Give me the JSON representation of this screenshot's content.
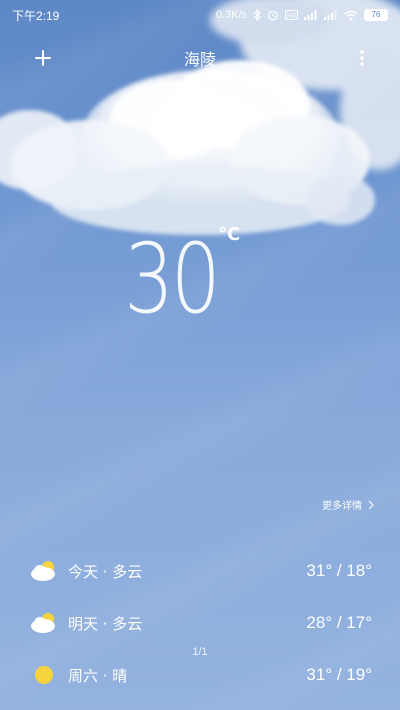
{
  "status_bar": {
    "time": "下午2:19",
    "network_speed": "0.3K/s",
    "battery_level": "76",
    "icons": [
      "bluetooth-icon",
      "alarm-icon",
      "hd-icon",
      "signal-icon",
      "signal-icon",
      "wifi-icon",
      "battery-icon"
    ]
  },
  "header": {
    "city": "海陵",
    "add_icon": "plus-icon",
    "menu_icon": "more-vertical-icon"
  },
  "current": {
    "temperature": "30",
    "unit": "°C"
  },
  "more_details": {
    "label": "更多详情"
  },
  "forecast": [
    {
      "label": "今天 · 多云",
      "temp": "31° / 18°",
      "icon": "partly-cloudy-icon"
    },
    {
      "label": "明天 · 多云",
      "temp": "28° / 17°",
      "icon": "partly-cloudy-icon"
    },
    {
      "label": "周六 · 晴",
      "temp": "31° / 19°",
      "icon": "sunny-icon"
    }
  ],
  "page_indicator": "1/1",
  "colors": {
    "sky_top": "#5d87c6",
    "sky_bottom": "#93b2df",
    "sun": "#f7d43d",
    "text": "#ffffff"
  }
}
